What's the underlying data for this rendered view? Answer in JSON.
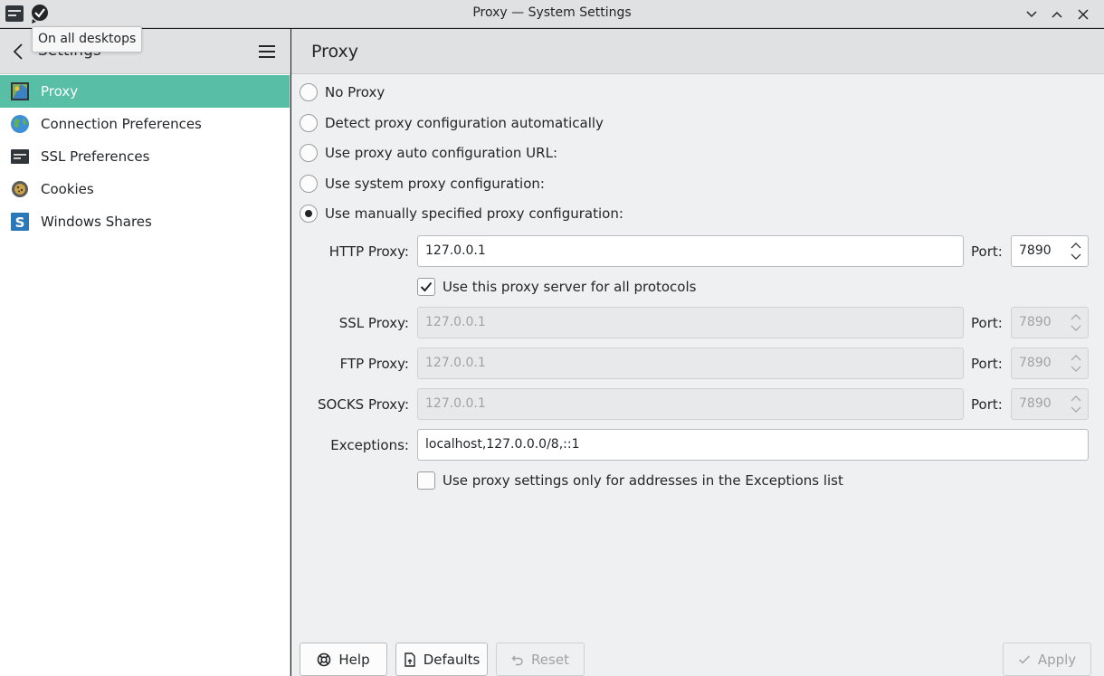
{
  "window": {
    "title": "Proxy — System Settings",
    "tooltip": "On all desktops"
  },
  "sidebar": {
    "title": "Settings",
    "items": [
      {
        "label": "Proxy",
        "icon": "proxy-icon",
        "active": true
      },
      {
        "label": "Connection Preferences",
        "icon": "globe-icon"
      },
      {
        "label": "SSL Preferences",
        "icon": "ssl-icon"
      },
      {
        "label": "Cookies",
        "icon": "cookie-icon"
      },
      {
        "label": "Windows Shares",
        "icon": "windows-shares-icon"
      }
    ]
  },
  "main": {
    "title": "Proxy",
    "options": [
      {
        "label": "No Proxy",
        "checked": false
      },
      {
        "label": "Detect proxy configuration automatically",
        "checked": false
      },
      {
        "label": "Use proxy auto configuration URL:",
        "checked": false
      },
      {
        "label": "Use system proxy configuration:",
        "checked": false
      },
      {
        "label": "Use manually specified proxy configuration:",
        "checked": true
      }
    ],
    "http": {
      "label": "HTTP Proxy:",
      "value": "127.0.0.1",
      "port_label": "Port:",
      "port": "7890"
    },
    "use_all": {
      "label": "Use this proxy server for all protocols",
      "checked": true
    },
    "ssl": {
      "label": "SSL Proxy:",
      "value": "127.0.0.1",
      "port_label": "Port:",
      "port": "7890"
    },
    "ftp": {
      "label": "FTP Proxy:",
      "value": "127.0.0.1",
      "port_label": "Port:",
      "port": "7890"
    },
    "socks": {
      "label": "SOCKS Proxy:",
      "value": "127.0.0.1",
      "port_label": "Port:",
      "port": "7890"
    },
    "exceptions": {
      "label": "Exceptions:",
      "value": "localhost,127.0.0.0/8,::1"
    },
    "exceptions_only": {
      "label": "Use proxy settings only for addresses in the Exceptions list",
      "checked": false
    }
  },
  "buttons": {
    "help": "Help",
    "defaults": "Defaults",
    "reset": "Reset",
    "apply": "Apply"
  },
  "colors": {
    "accent": "#58bfa6"
  }
}
